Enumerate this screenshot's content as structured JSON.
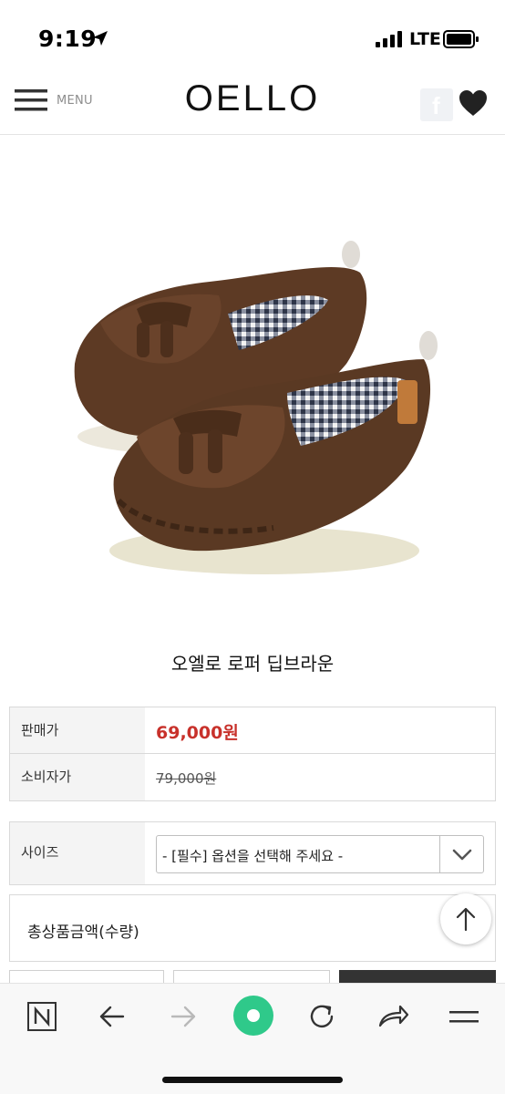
{
  "status_bar": {
    "time": "9:19",
    "network": "LTE"
  },
  "header": {
    "menu_label": "MENU",
    "logo": "OELLO",
    "facebook_letter": "f"
  },
  "product": {
    "name": "오엘로 로퍼 딥브라운",
    "image_icon": "brown-leather-tassel-loafers-photo"
  },
  "price_table": {
    "sale_label": "판매가",
    "sale_price": "69,000원",
    "consumer_label": "소비자가",
    "consumer_price": "79,000원"
  },
  "options": {
    "size_label": "사이즈",
    "size_select": "- [필수] 옵션을 선택해 주세요 -"
  },
  "total": {
    "label": "총상품금액(수량)"
  },
  "colors": {
    "sale_price": "#c8312b",
    "browser_green": "#2fc98a"
  },
  "browser_nav": {
    "icons": [
      "naver-n-icon",
      "back-arrow-icon",
      "forward-arrow-icon",
      "green-dot-icon",
      "reload-icon",
      "share-icon",
      "menu-icon"
    ]
  }
}
